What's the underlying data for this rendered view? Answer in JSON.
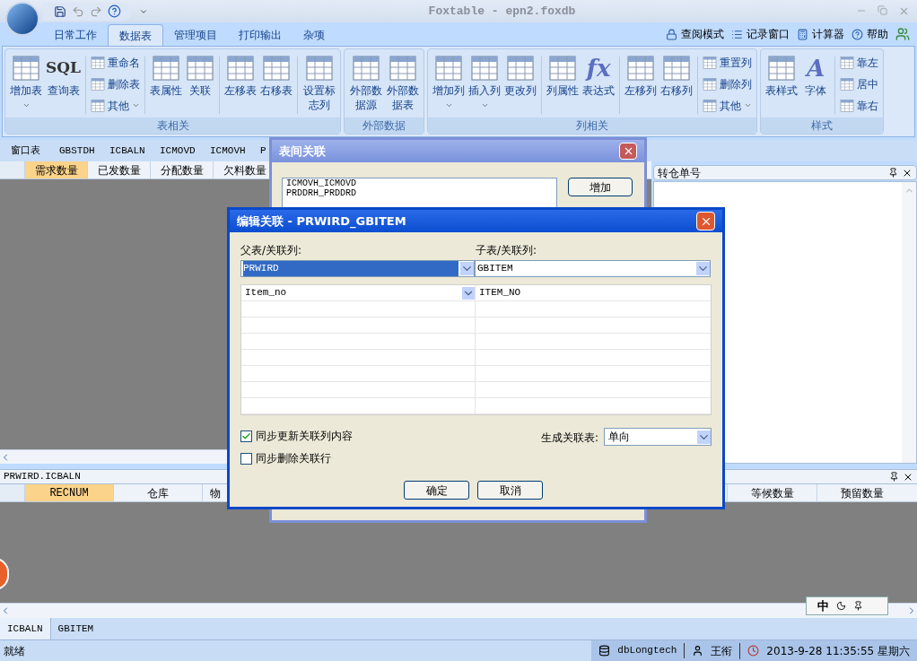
{
  "window": {
    "title": "Foxtable - epn2.foxdb"
  },
  "ribbon_tabs": [
    {
      "label": "日常工作",
      "selected": false
    },
    {
      "label": "数据表",
      "selected": true
    },
    {
      "label": "管理项目",
      "selected": false
    },
    {
      "label": "打印输出",
      "selected": false
    },
    {
      "label": "杂项",
      "selected": false
    }
  ],
  "top_links": [
    "查阅模式",
    "记录窗口",
    "计算器",
    "帮助"
  ],
  "ribbon_groups": [
    {
      "title": "表相关",
      "items": [
        {
          "kind": "large",
          "label": "增加表",
          "dropdown": true
        },
        {
          "kind": "large",
          "label": "查询表",
          "icon_text": "SQL"
        },
        {
          "kind": "separator"
        },
        {
          "kind": "small_column",
          "items": [
            {
              "label": "重命名",
              "dropdown": false
            },
            {
              "label": "删除表",
              "dropdown": false
            },
            {
              "label": "其他",
              "dropdown": true
            }
          ]
        },
        {
          "kind": "separator"
        },
        {
          "kind": "large",
          "label": "表属性"
        },
        {
          "kind": "large",
          "label": "关联"
        },
        {
          "kind": "separator"
        },
        {
          "kind": "large",
          "label": "左移表"
        },
        {
          "kind": "large",
          "label": "右移表"
        },
        {
          "kind": "separator"
        },
        {
          "kind": "large_two_line",
          "label": "设置标志列"
        }
      ]
    },
    {
      "title": "外部数据",
      "items": [
        {
          "kind": "large_two_line",
          "label": "外部数据源"
        },
        {
          "kind": "large_two_line",
          "label": "外部数据表"
        }
      ]
    },
    {
      "title": "列相关",
      "items": [
        {
          "kind": "large",
          "label": "增加列",
          "dropdown": true
        },
        {
          "kind": "large",
          "label": "插入列",
          "dropdown": true
        },
        {
          "kind": "large",
          "label": "更改列"
        },
        {
          "kind": "separator"
        },
        {
          "kind": "large",
          "label": "列属性"
        },
        {
          "kind": "large",
          "label": "表达式",
          "icon_text": "fx"
        },
        {
          "kind": "separator"
        },
        {
          "kind": "large",
          "label": "左移列"
        },
        {
          "kind": "large",
          "label": "右移列"
        },
        {
          "kind": "separator"
        },
        {
          "kind": "small_column",
          "items": [
            {
              "label": "重置列",
              "dropdown": false
            },
            {
              "label": "删除列",
              "dropdown": false
            },
            {
              "label": "其他",
              "dropdown": true
            }
          ]
        }
      ]
    },
    {
      "title": "样式",
      "items": [
        {
          "kind": "large",
          "label": "表样式"
        },
        {
          "kind": "large",
          "label": "字体",
          "icon_text": "A"
        },
        {
          "kind": "separator"
        },
        {
          "kind": "small_column",
          "items": [
            {
              "label": "靠左",
              "dropdown": false
            },
            {
              "label": "居中",
              "dropdown": false
            },
            {
              "label": "靠右",
              "dropdown": false
            }
          ]
        }
      ]
    }
  ],
  "window_tabs": [
    "窗口表",
    "GBSTDH",
    "ICBALN",
    "ICMOVD",
    "ICMOVH",
    "P"
  ],
  "upper_grid": {
    "columns": [
      {
        "label": "需求数量",
        "selected": true
      },
      {
        "label": "已发数量",
        "selected": false
      },
      {
        "label": "分配数量",
        "selected": false
      },
      {
        "label": "欠料数量",
        "selected": false
      }
    ]
  },
  "side_panel": {
    "title": "转仓单号"
  },
  "lower_panel": {
    "title": "PRWIRD.ICBALN",
    "columns_left": [
      {
        "label": "RECNUM",
        "selected": true
      },
      {
        "label": "仓库",
        "selected": false
      },
      {
        "label": "物",
        "selected": false
      }
    ],
    "columns_right": [
      {
        "label": "等候数量",
        "selected": false
      },
      {
        "label": "预留数量",
        "selected": false
      }
    ]
  },
  "ime_bar": {
    "label": "中"
  },
  "sheet_tabs": [
    {
      "label": "ICBALN",
      "selected": true
    },
    {
      "label": "GBITEM",
      "selected": false
    }
  ],
  "status_bar": {
    "status": "就绪",
    "database": "dbLongtech",
    "user": "王衔",
    "datetime": "2013-9-28 11:35:55 星期六"
  },
  "relations_dialog": {
    "title": "表间关联",
    "relations": [
      "ICMOVH_ICMOVD",
      "PRDDRH_PRDDRD"
    ],
    "add_button": "增加"
  },
  "edit_dialog": {
    "title": "编辑关联 - PRWIRD_GBITEM",
    "parent_label": "父表/关联列:",
    "parent_table": {
      "value": "PRWIRD",
      "highlighted": true
    },
    "child_label": "子表/关联列:",
    "child_table": {
      "value": "GBITEM",
      "highlighted": false
    },
    "column_pairs": [
      {
        "parent": "Item_no",
        "child": "ITEM_NO"
      }
    ],
    "options": [
      {
        "label": "同步更新关联列内容",
        "checked": true
      },
      {
        "label": "同步删除关联行",
        "checked": false
      }
    ],
    "generate_label": "生成关联表:",
    "generate_value": "单向",
    "buttons": [
      "确定",
      "取消"
    ]
  }
}
